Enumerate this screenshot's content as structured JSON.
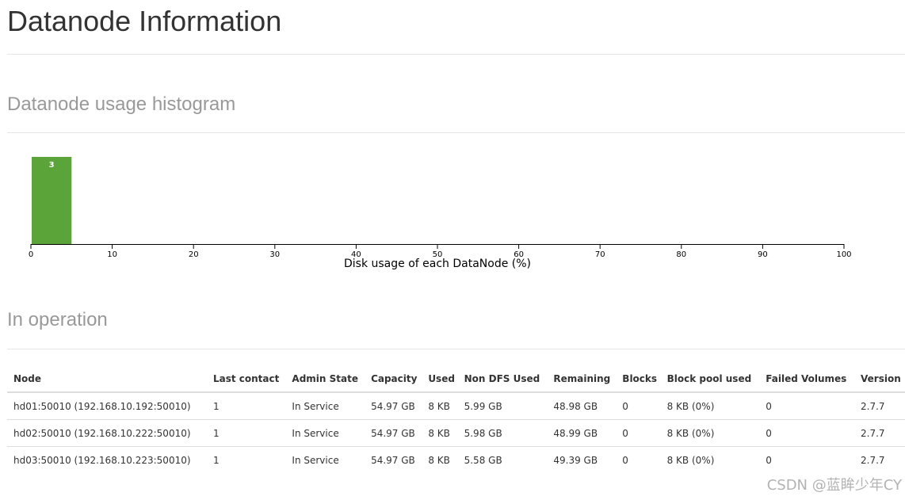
{
  "header": {
    "title": "Datanode Information"
  },
  "histogram": {
    "title": "Datanode usage histogram",
    "xlabel": "Disk usage of each DataNode (%)",
    "bar_color": "#5ba43a",
    "axis_color": "#000000"
  },
  "chart_data": {
    "type": "bar",
    "title": "",
    "xlabel": "Disk usage of each DataNode (%)",
    "ylabel": "",
    "xlim": [
      0,
      100
    ],
    "xticks": [
      0,
      10,
      20,
      30,
      40,
      50,
      60,
      70,
      80,
      90,
      100
    ],
    "bins": [
      {
        "x0": 0,
        "x1": 5,
        "count": 3,
        "label": "3"
      }
    ]
  },
  "operation": {
    "title": "In operation",
    "columns": [
      "Node",
      "Last contact",
      "Admin State",
      "Capacity",
      "Used",
      "Non DFS Used",
      "Remaining",
      "Blocks",
      "Block pool used",
      "Failed Volumes",
      "Version"
    ],
    "rows": [
      [
        "hd01:50010 (192.168.10.192:50010)",
        "1",
        "In Service",
        "54.97 GB",
        "8 KB",
        "5.99 GB",
        "48.98 GB",
        "0",
        "8 KB (0%)",
        "0",
        "2.7.7"
      ],
      [
        "hd02:50010 (192.168.10.222:50010)",
        "1",
        "In Service",
        "54.97 GB",
        "8 KB",
        "5.98 GB",
        "48.99 GB",
        "0",
        "8 KB (0%)",
        "0",
        "2.7.7"
      ],
      [
        "hd03:50010 (192.168.10.223:50010)",
        "1",
        "In Service",
        "54.97 GB",
        "8 KB",
        "5.58 GB",
        "49.39 GB",
        "0",
        "8 KB (0%)",
        "0",
        "2.7.7"
      ]
    ]
  },
  "watermark": "CSDN @蓝眸少年CY"
}
